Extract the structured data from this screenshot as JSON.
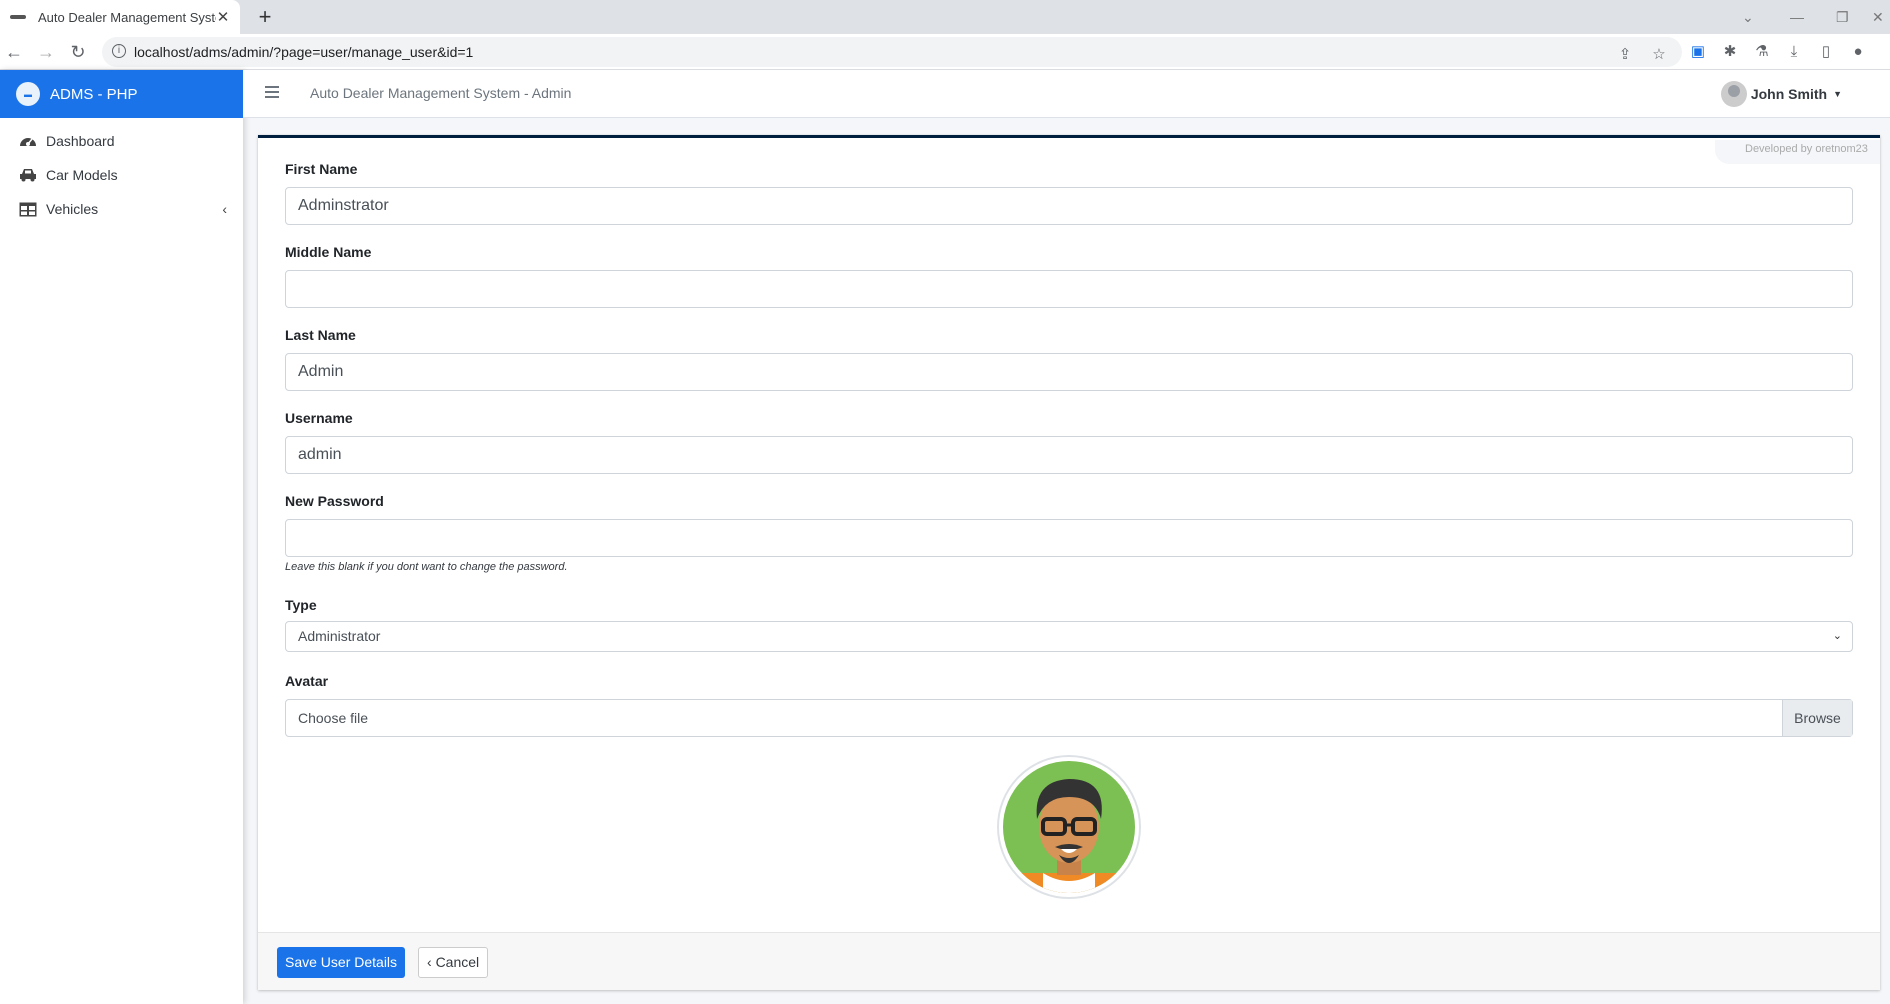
{
  "browser": {
    "tab_title": "Auto Dealer Management System",
    "url": "localhost/adms/admin/?page=user/manage_user&id=1"
  },
  "sidebar": {
    "brand": "ADMS - PHP",
    "items": [
      {
        "label": "Dashboard",
        "icon": "tachometer-icon"
      },
      {
        "label": "Car Models",
        "icon": "car-icon"
      },
      {
        "label": "Vehicles",
        "icon": "table-icon"
      }
    ]
  },
  "topnav": {
    "system_name": "Auto Dealer Management System - Admin",
    "user_name": "John Smith"
  },
  "card": {
    "developed_by": "Developed by oretnom23"
  },
  "form": {
    "first_name": {
      "label": "First Name",
      "value": "Adminstrator"
    },
    "middle_name": {
      "label": "Middle Name",
      "value": ""
    },
    "last_name": {
      "label": "Last Name",
      "value": "Admin"
    },
    "username": {
      "label": "Username",
      "value": "admin"
    },
    "password": {
      "label": "New Password",
      "value": "",
      "help": "Leave this blank if you dont want to change the password."
    },
    "type": {
      "label": "Type",
      "selected": "Administrator"
    },
    "avatar": {
      "label": "Avatar",
      "placeholder": "Choose file",
      "browse": "Browse"
    }
  },
  "footer": {
    "save_label": "Save User Details",
    "cancel_label": "Cancel"
  },
  "colors": {
    "primary": "#1a73e8",
    "card_top_border": "#001f3f"
  }
}
